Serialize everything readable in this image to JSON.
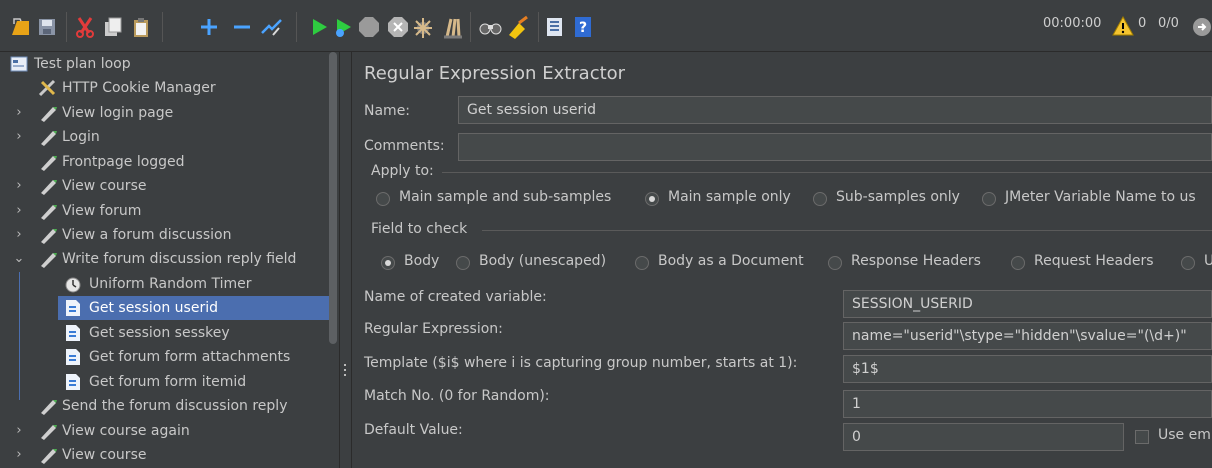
{
  "toolbar": {
    "buttons": [
      {
        "name": "templates-icon"
      },
      {
        "name": "save-icon"
      },
      {
        "name": "cut-icon"
      },
      {
        "name": "copy-icon"
      },
      {
        "name": "paste-icon"
      },
      {
        "name": "expand-icon"
      },
      {
        "name": "collapse-icon"
      },
      {
        "name": "toggle-icon"
      },
      {
        "name": "start-icon"
      },
      {
        "name": "start-no-pause-icon"
      },
      {
        "name": "stop-icon"
      },
      {
        "name": "shutdown-icon"
      },
      {
        "name": "clear-icon"
      },
      {
        "name": "clear-all-icon"
      },
      {
        "name": "search-icon"
      },
      {
        "name": "reset-search-icon"
      },
      {
        "name": "function-helper-icon"
      },
      {
        "name": "help-icon"
      }
    ],
    "status": {
      "timer": "00:00:00",
      "warnings": "0",
      "threads": "0/0"
    }
  },
  "tree": {
    "items": [
      {
        "label": "Test plan loop",
        "icon": "test-plan-icon",
        "arrow": ""
      },
      {
        "label": "HTTP Cookie Manager",
        "icon": "tools-icon",
        "arrow": ""
      },
      {
        "label": "View login page",
        "icon": "sampler-pencil-icon",
        "arrow": "›"
      },
      {
        "label": "Login",
        "icon": "sampler-pencil-icon",
        "arrow": "›"
      },
      {
        "label": "Frontpage logged",
        "icon": "sampler-pencil-icon",
        "arrow": ""
      },
      {
        "label": "View course",
        "icon": "sampler-pencil-icon",
        "arrow": "›"
      },
      {
        "label": "View forum",
        "icon": "sampler-pencil-icon",
        "arrow": "›"
      },
      {
        "label": "View a forum discussion",
        "icon": "sampler-pencil-icon",
        "arrow": "›"
      },
      {
        "label": "Write forum discussion reply field",
        "icon": "sampler-pencil-icon",
        "arrow": "⌄"
      },
      {
        "label": "Uniform Random Timer",
        "icon": "timer-icon",
        "arrow": ""
      },
      {
        "label": "Get session userid",
        "icon": "extractor-icon",
        "arrow": ""
      },
      {
        "label": "Get session sesskey",
        "icon": "extractor-icon",
        "arrow": ""
      },
      {
        "label": "Get forum form attachments",
        "icon": "extractor-icon",
        "arrow": ""
      },
      {
        "label": "Get forum form itemid",
        "icon": "extractor-icon",
        "arrow": ""
      },
      {
        "label": "Send the forum discussion reply",
        "icon": "sampler-pencil-icon",
        "arrow": ""
      },
      {
        "label": "View course again",
        "icon": "sampler-pencil-icon",
        "arrow": "›"
      },
      {
        "label": "View course",
        "icon": "sampler-pencil-icon",
        "arrow": "›"
      }
    ],
    "selected_index": 10
  },
  "panel": {
    "title": "Regular Expression Extractor",
    "name_label": "Name:",
    "name_value": "Get session userid",
    "comments_label": "Comments:",
    "comments_value": "",
    "apply_to": {
      "legend": "Apply to:",
      "options": [
        "Main sample and sub-samples",
        "Main sample only",
        "Sub-samples only",
        "JMeter Variable Name to us"
      ],
      "selected": 1
    },
    "field_to_check": {
      "legend": "Field to check",
      "options": [
        "Body",
        "Body (unescaped)",
        "Body as a Document",
        "Response Headers",
        "Request Headers",
        "U"
      ],
      "selected": 0
    },
    "var_name_label": "Name of created variable:",
    "var_name_value": "SESSION_USERID",
    "regex_label": "Regular Expression:",
    "regex_value": "name=\"userid\"\\stype=\"hidden\"\\svalue=\"(\\d+)\"",
    "template_label": "Template ($i$ where i is capturing group number, starts at 1):",
    "template_value": "$1$",
    "match_label": "Match No. (0 for Random):",
    "match_value": "1",
    "default_label": "Default Value:",
    "default_value": "0",
    "use_empty_label": "Use em"
  }
}
